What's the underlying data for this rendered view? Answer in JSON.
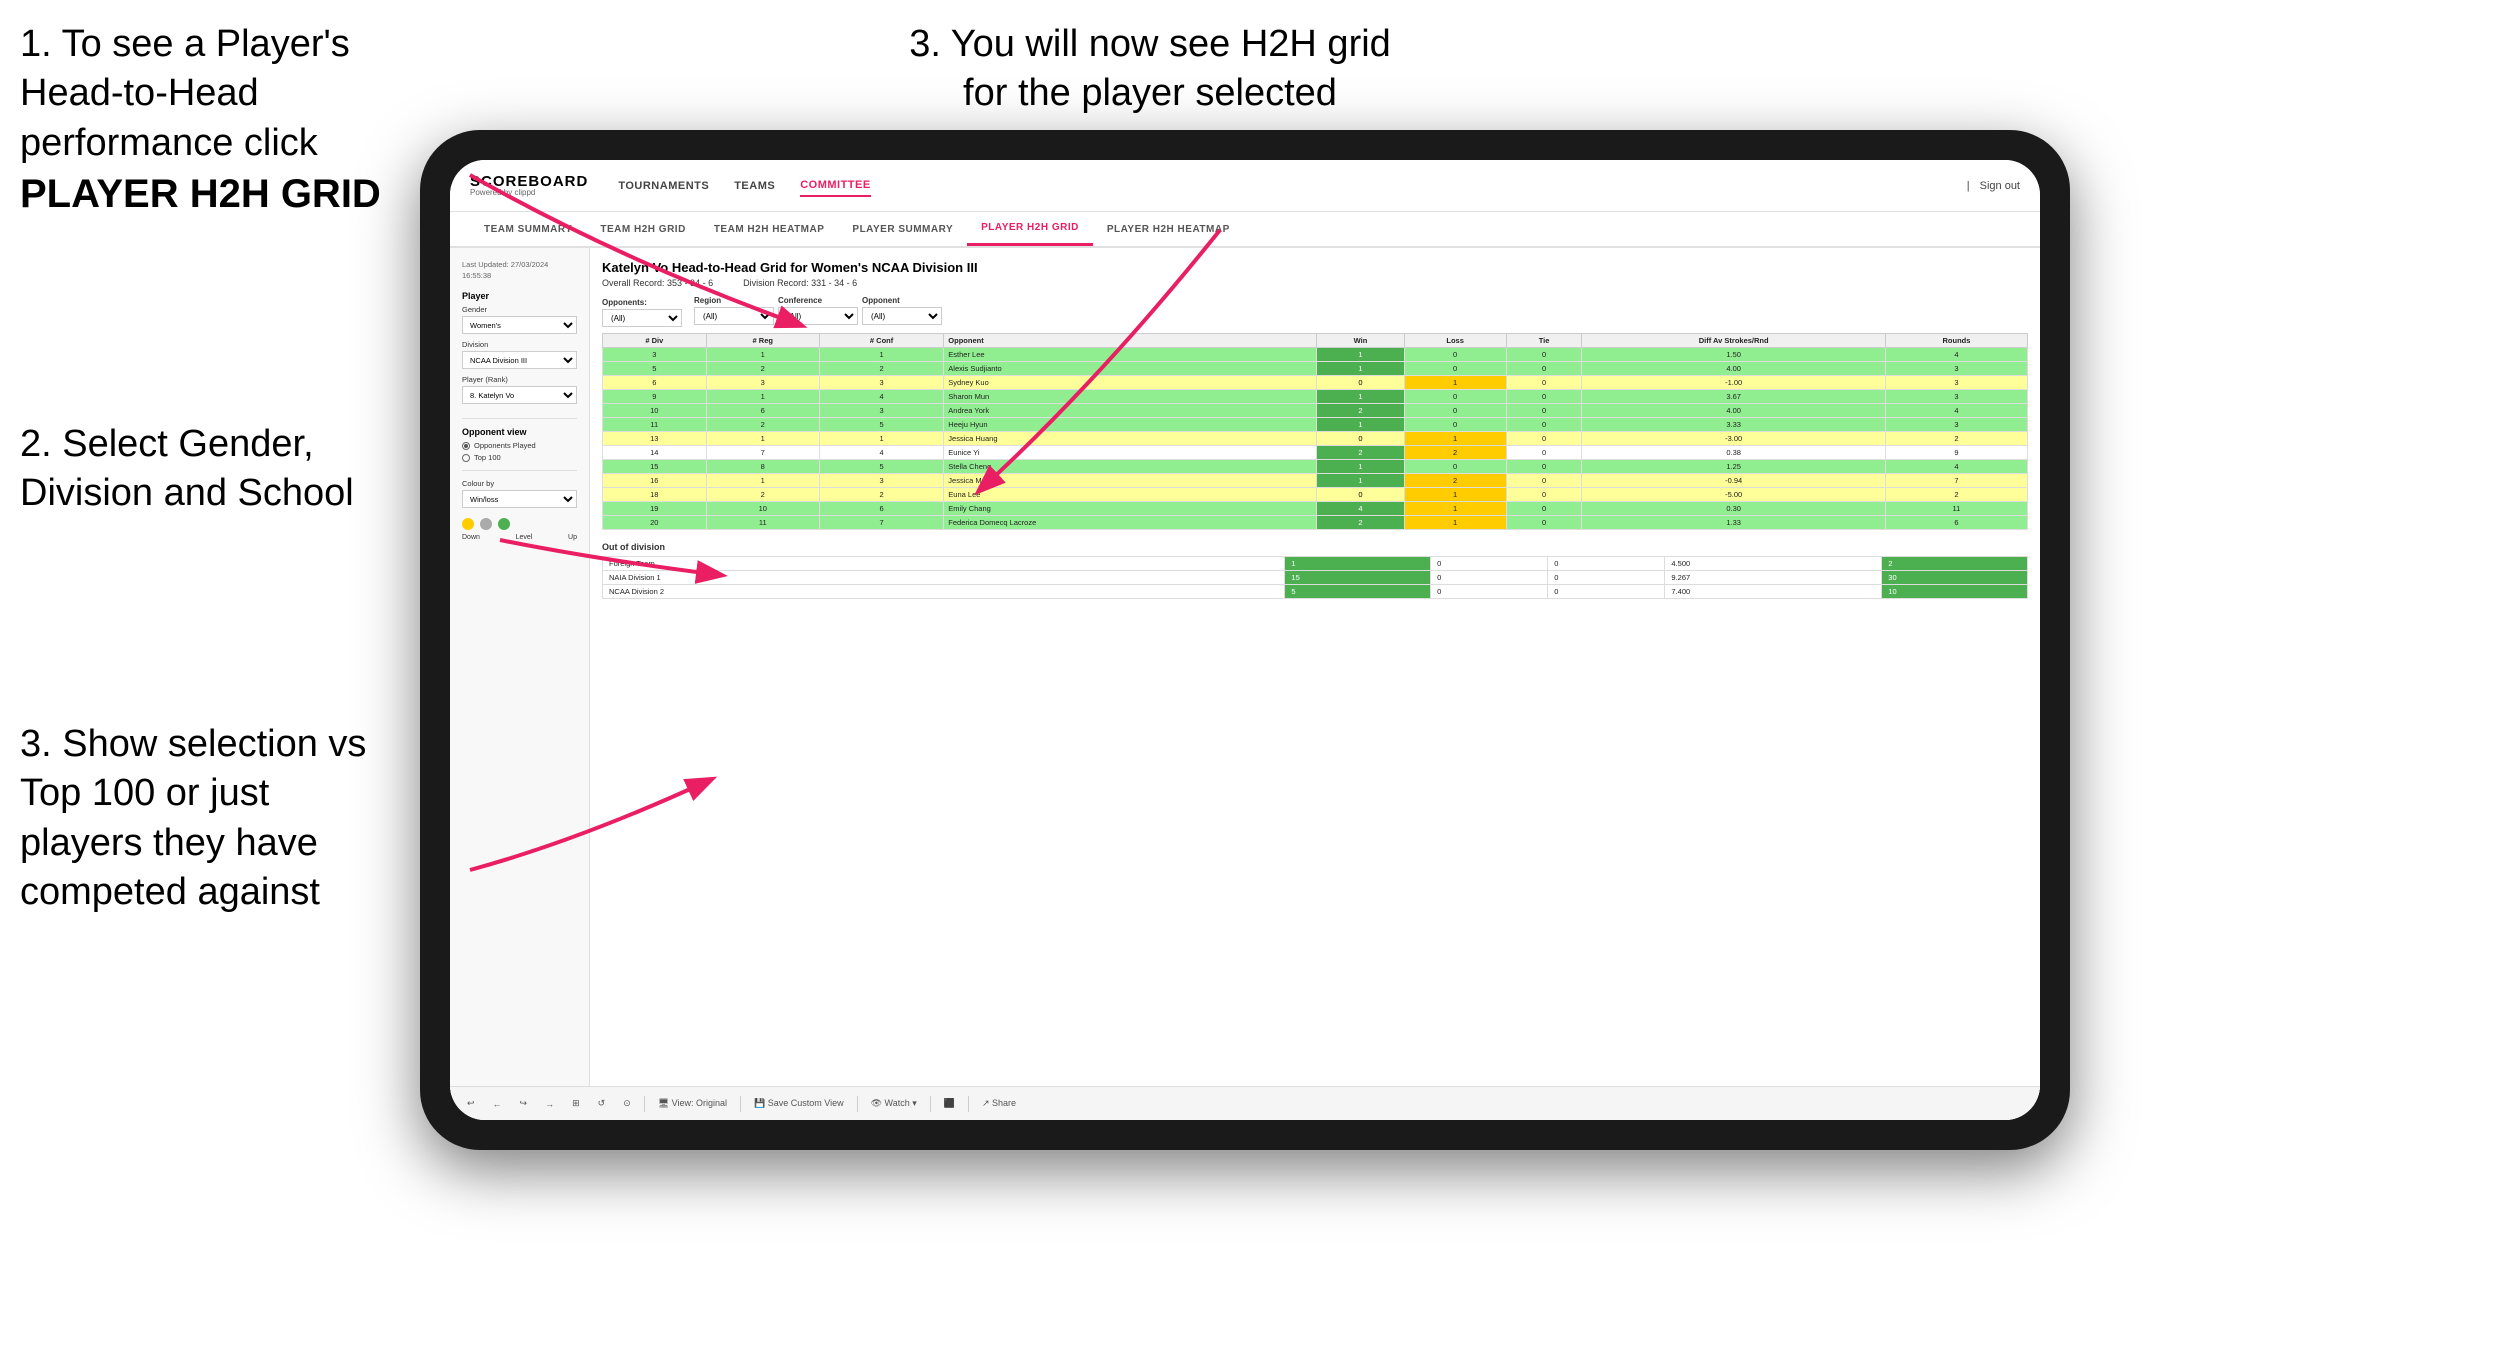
{
  "instructions": {
    "step1_title": "1. To see a Player's Head-to-Head performance click",
    "step1_bold": "PLAYER H2H GRID",
    "step2": "2. Select Gender, Division and School",
    "step3_left": "3. Show selection vs Top 100 or just players they have competed against",
    "step3_right": "3. You will now see H2H grid for the player selected"
  },
  "app": {
    "logo_main": "SCOREBOARD",
    "logo_sub": "Powered by clippd",
    "nav": [
      "TOURNAMENTS",
      "TEAMS",
      "COMMITTEE"
    ],
    "nav_active": "COMMITTEE",
    "header_right": "Sign out",
    "sub_nav": [
      "TEAM SUMMARY",
      "TEAM H2H GRID",
      "TEAM H2H HEATMAP",
      "PLAYER SUMMARY",
      "PLAYER H2H GRID",
      "PLAYER H2H HEATMAP"
    ],
    "sub_nav_active": "PLAYER H2H GRID"
  },
  "sidebar": {
    "timestamp": "Last Updated: 27/03/2024\n16:55:38",
    "player_section": "Player",
    "gender_label": "Gender",
    "gender_value": "Women's",
    "division_label": "Division",
    "division_value": "NCAA Division III",
    "player_rank_label": "Player (Rank)",
    "player_rank_value": "8. Katelyn Vo",
    "opponent_view_label": "Opponent view",
    "opponent_options": [
      "Opponents Played",
      "Top 100"
    ],
    "opponent_selected": "Opponents Played",
    "colour_by_label": "Colour by",
    "colour_value": "Win/loss",
    "colour_legend": {
      "down_label": "Down",
      "level_label": "Level",
      "up_label": "Up"
    }
  },
  "main": {
    "title": "Katelyn Vo Head-to-Head Grid for Women's NCAA Division III",
    "overall_record_label": "Overall Record:",
    "overall_record": "353 - 34 - 6",
    "division_record_label": "Division Record:",
    "division_record": "331 - 34 - 6",
    "filter_opponents_label": "Opponents:",
    "filter_opponents_value": "(All)",
    "filter_region_label": "Region",
    "filter_region_value": "(All)",
    "filter_conference_label": "Conference",
    "filter_conference_value": "(All)",
    "filter_opponent_label": "Opponent",
    "filter_opponent_value": "(All)",
    "table_headers": [
      "# Div",
      "# Reg",
      "# Conf",
      "Opponent",
      "Win",
      "Loss",
      "Tie",
      "Diff Av Strokes/Rnd",
      "Rounds"
    ],
    "table_rows": [
      {
        "div": "3",
        "reg": "1",
        "conf": "1",
        "opponent": "Esther Lee",
        "win": 1,
        "loss": 0,
        "tie": 0,
        "diff": "1.50",
        "rounds": 4,
        "color": "green"
      },
      {
        "div": "5",
        "reg": "2",
        "conf": "2",
        "opponent": "Alexis Sudjianto",
        "win": 1,
        "loss": 0,
        "tie": 0,
        "diff": "4.00",
        "rounds": 3,
        "color": "green"
      },
      {
        "div": "6",
        "reg": "3",
        "conf": "3",
        "opponent": "Sydney Kuo",
        "win": 0,
        "loss": 1,
        "tie": 0,
        "diff": "-1.00",
        "rounds": 3,
        "color": "yellow"
      },
      {
        "div": "9",
        "reg": "1",
        "conf": "4",
        "opponent": "Sharon Mun",
        "win": 1,
        "loss": 0,
        "tie": 0,
        "diff": "3.67",
        "rounds": 3,
        "color": "green"
      },
      {
        "div": "10",
        "reg": "6",
        "conf": "3",
        "opponent": "Andrea York",
        "win": 2,
        "loss": 0,
        "tie": 0,
        "diff": "4.00",
        "rounds": 4,
        "color": "green"
      },
      {
        "div": "11",
        "reg": "2",
        "conf": "5",
        "opponent": "Heeju Hyun",
        "win": 1,
        "loss": 0,
        "tie": 0,
        "diff": "3.33",
        "rounds": 3,
        "color": "green"
      },
      {
        "div": "13",
        "reg": "1",
        "conf": "1",
        "opponent": "Jessica Huang",
        "win": 0,
        "loss": 1,
        "tie": 0,
        "diff": "-3.00",
        "rounds": 2,
        "color": "yellow"
      },
      {
        "div": "14",
        "reg": "7",
        "conf": "4",
        "opponent": "Eunice Yi",
        "win": 2,
        "loss": 2,
        "tie": 0,
        "diff": "0.38",
        "rounds": 9,
        "color": "white"
      },
      {
        "div": "15",
        "reg": "8",
        "conf": "5",
        "opponent": "Stella Cheng",
        "win": 1,
        "loss": 0,
        "tie": 0,
        "diff": "1.25",
        "rounds": 4,
        "color": "green"
      },
      {
        "div": "16",
        "reg": "1",
        "conf": "3",
        "opponent": "Jessica Mason",
        "win": 1,
        "loss": 2,
        "tie": 0,
        "diff": "-0.94",
        "rounds": 7,
        "color": "yellow"
      },
      {
        "div": "18",
        "reg": "2",
        "conf": "2",
        "opponent": "Euna Lee",
        "win": 0,
        "loss": 1,
        "tie": 0,
        "diff": "-5.00",
        "rounds": 2,
        "color": "yellow"
      },
      {
        "div": "19",
        "reg": "10",
        "conf": "6",
        "opponent": "Emily Chang",
        "win": 4,
        "loss": 1,
        "tie": 0,
        "diff": "0.30",
        "rounds": 11,
        "color": "green"
      },
      {
        "div": "20",
        "reg": "11",
        "conf": "7",
        "opponent": "Federica Domecq Lacroze",
        "win": 2,
        "loss": 1,
        "tie": 0,
        "diff": "1.33",
        "rounds": 6,
        "color": "green"
      }
    ],
    "out_of_division_title": "Out of division",
    "out_of_division_rows": [
      {
        "name": "Foreign Team",
        "win": 1,
        "loss": 0,
        "tie": 0,
        "diff": "4.500",
        "rounds": 2,
        "color": "green"
      },
      {
        "name": "NAIA Division 1",
        "win": 15,
        "loss": 0,
        "tie": 0,
        "diff": "9.267",
        "rounds": 30,
        "color": "green"
      },
      {
        "name": "NCAA Division 2",
        "win": 5,
        "loss": 0,
        "tie": 0,
        "diff": "7.400",
        "rounds": 10,
        "color": "green"
      }
    ]
  },
  "toolbar": {
    "items": [
      "↩",
      "←",
      "↪",
      "→",
      "⊞",
      "↺",
      "⊙",
      "View: Original",
      "Save Custom View",
      "👁 Watch ▾",
      "⬛",
      "Share"
    ]
  }
}
